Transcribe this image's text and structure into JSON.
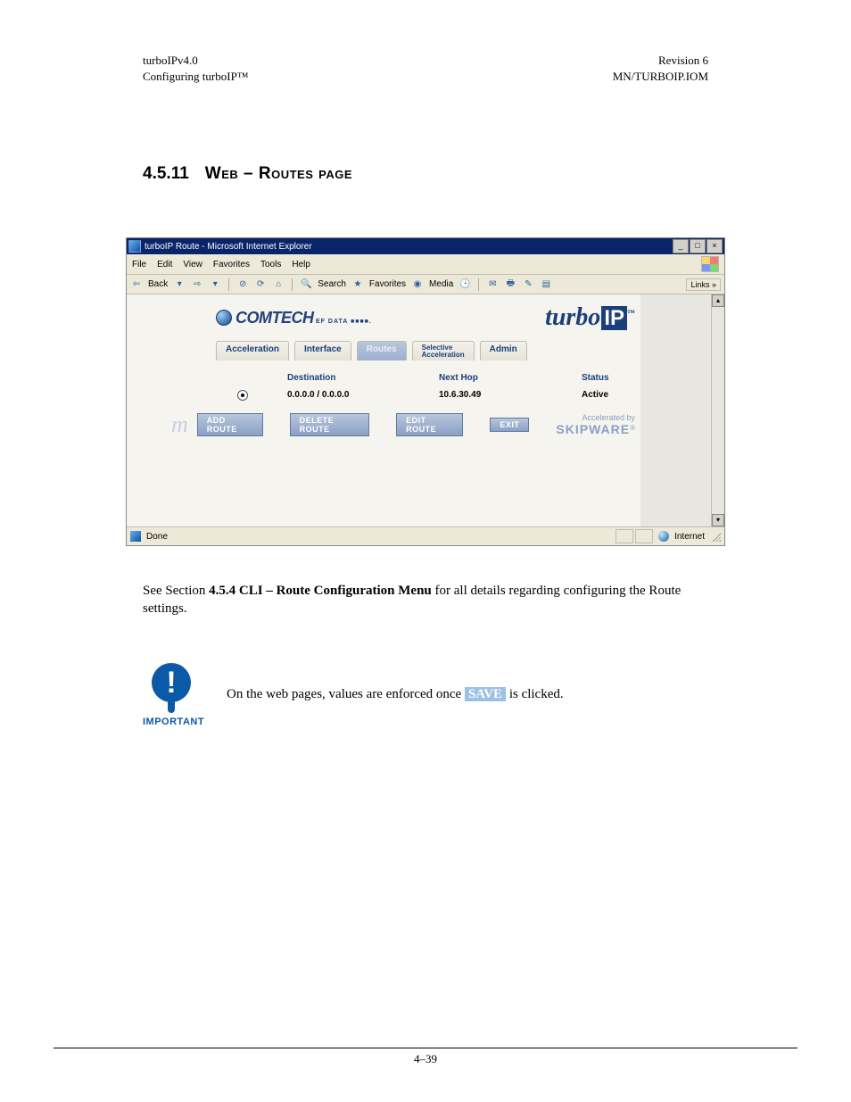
{
  "doc": {
    "header_left_1": "turboIPv4.0",
    "header_left_2": "Configuring turboIP™",
    "header_right_1": "Revision 6",
    "header_right_2": "MN/TURBOIP.IOM",
    "section_number": "4.5.11",
    "section_title": "Web – Routes page",
    "body_sentence_pre": "See Section ",
    "body_sentence_bold": "4.5.4 CLI – Route Configuration Menu",
    "body_sentence_post": " for all details regarding configuring the Route settings.",
    "important_label": "IMPORTANT",
    "important_text_pre": "On the web pages, values are enforced once ",
    "important_save": "SAVE",
    "important_text_post": " is clicked.",
    "page_footer": "4–39"
  },
  "ie": {
    "title": "turboIP Route - Microsoft Internet Explorer",
    "menus": [
      "File",
      "Edit",
      "View",
      "Favorites",
      "Tools",
      "Help"
    ],
    "toolbar": {
      "back": "Back",
      "search": "Search",
      "favorites": "Favorites",
      "media": "Media",
      "links": "Links"
    },
    "status_done": "Done",
    "status_zone": "Internet"
  },
  "app": {
    "brand_left": "COMTECH",
    "brand_left_sub": "EF DATA ■■■■.",
    "brand_right": "turbo",
    "brand_right_ip": "IP",
    "tabs": [
      {
        "label": "Acceleration"
      },
      {
        "label": "Interface"
      },
      {
        "label": "Routes"
      },
      {
        "label": "Selective",
        "label2": "Acceleration"
      },
      {
        "label": "Admin"
      }
    ],
    "columns": {
      "destination": "Destination",
      "nexthop": "Next Hop",
      "status": "Status"
    },
    "row": {
      "destination": "0.0.0.0 / 0.0.0.0",
      "nexthop": "10.6.30.49",
      "status": "Active"
    },
    "buttons": {
      "add": "ADD ROUTE",
      "delete": "DELETE ROUTE",
      "edit": "EDIT ROUTE",
      "exit": "EXIT"
    },
    "accel_by": "Accelerated by",
    "skipware": "SKIPWARE"
  }
}
